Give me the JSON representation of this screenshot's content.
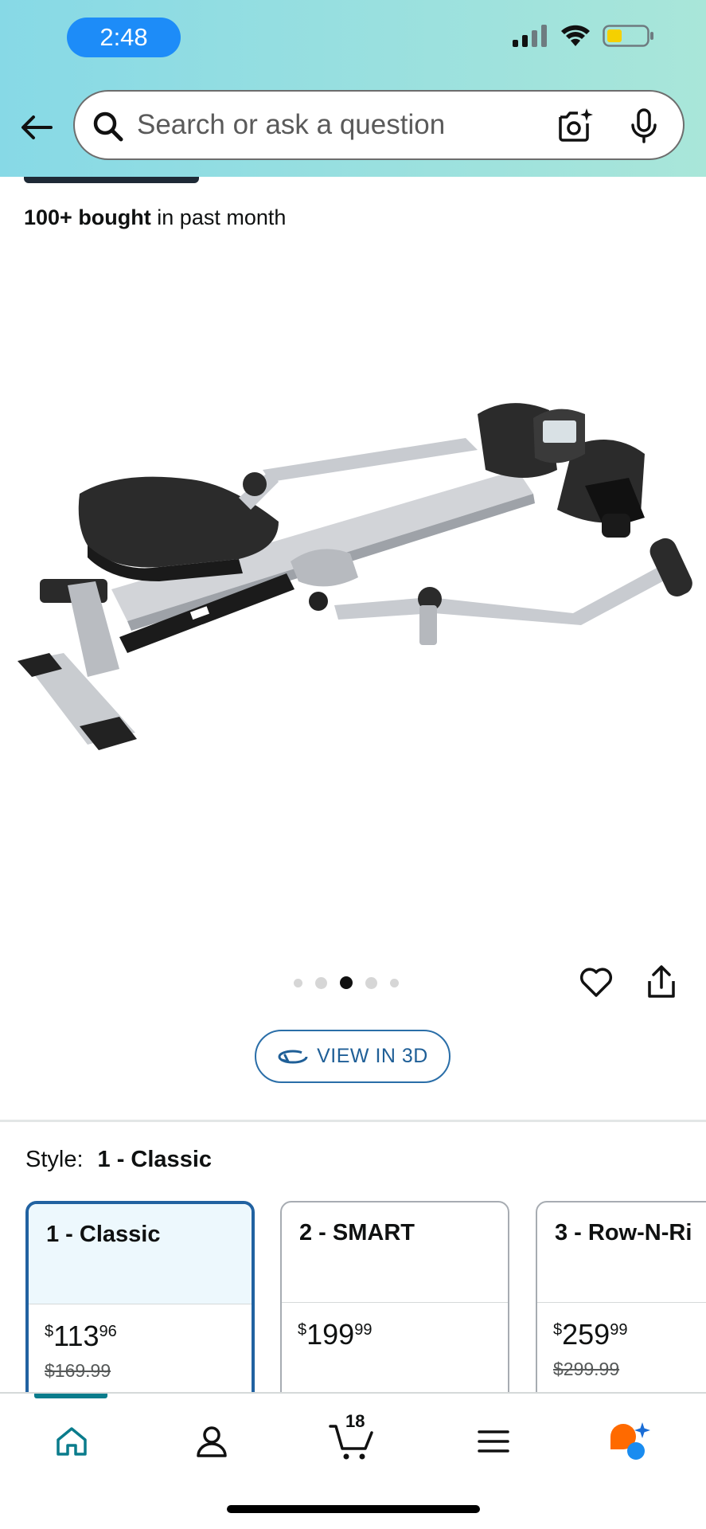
{
  "status_bar": {
    "time": "2:48"
  },
  "search": {
    "placeholder": "Search or ask a question"
  },
  "product": {
    "bought_bold": "100+ bought",
    "bought_rest": " in past month",
    "carousel": {
      "count": 5,
      "active_index": 2
    },
    "view_3d_label": "VIEW IN 3D"
  },
  "style": {
    "label": "Style:",
    "selected": "1 - Classic",
    "options": [
      {
        "name": "1 - Classic",
        "price_whole": "113",
        "price_fraction": "96",
        "currency": "$",
        "list_price": "$169.99",
        "selected": true
      },
      {
        "name": "2 - SMART",
        "price_whole": "199",
        "price_fraction": "99",
        "currency": "$",
        "list_price": "",
        "selected": false
      },
      {
        "name": "3 - Row-N-Ri",
        "price_whole": "259",
        "price_fraction": "99",
        "currency": "$",
        "list_price": "$299.99",
        "selected": false
      }
    ]
  },
  "bottom_nav": {
    "items": [
      "home-icon",
      "account-icon",
      "cart-icon",
      "menu-icon",
      "rufus-icon"
    ],
    "cart_count": "18"
  },
  "colors": {
    "accent": "#2162a1",
    "nav_active": "#0a7c8c",
    "time_pill": "#1d8cf8"
  }
}
